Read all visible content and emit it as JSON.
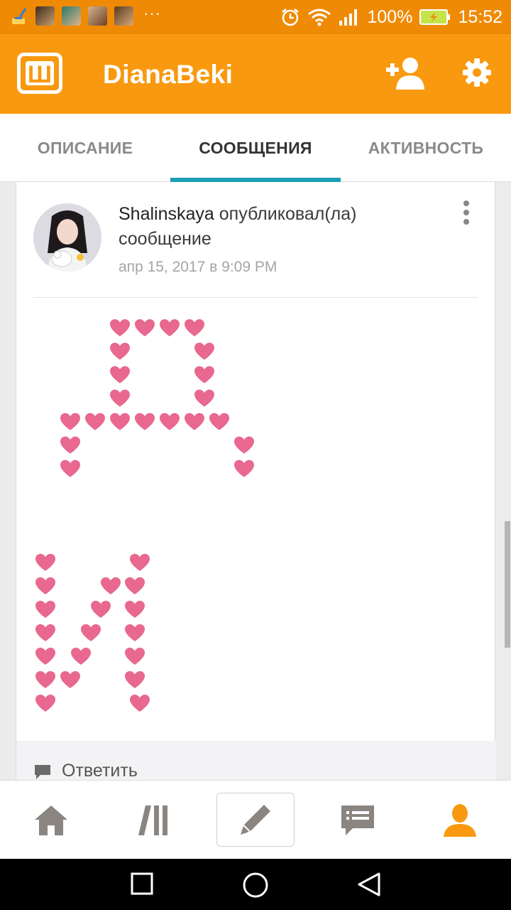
{
  "status_bar": {
    "battery": "100%",
    "time": "15:52",
    "more": "···"
  },
  "app_bar": {
    "logo_letter": "Ш",
    "title": "DianaBeki",
    "add_user_icon": "add-user-icon",
    "settings_icon": "gear-icon"
  },
  "tabs": [
    {
      "label": "ОПИСАНИЕ",
      "active": false
    },
    {
      "label": "СООБЩЕНИЯ",
      "active": true
    },
    {
      "label": "АКТИВНОСТЬ",
      "active": false
    }
  ],
  "post": {
    "author": "Shalinskaya",
    "action": " опубликовал(ла) сообщение",
    "date": "апр 15, 2017 в 9:09 PM",
    "heart_color": "#e8688f",
    "reply_label": "Ответить"
  },
  "bottom_nav": [
    {
      "name": "home-icon"
    },
    {
      "name": "library-icon"
    },
    {
      "name": "pencil-icon"
    },
    {
      "name": "messages-icon"
    },
    {
      "name": "profile-icon",
      "active": true
    }
  ],
  "colors": {
    "accent": "#f8990f",
    "status_bar": "#ef8a05",
    "tab_indicator": "#1a9fb5",
    "active_nav": "#f8990f"
  }
}
